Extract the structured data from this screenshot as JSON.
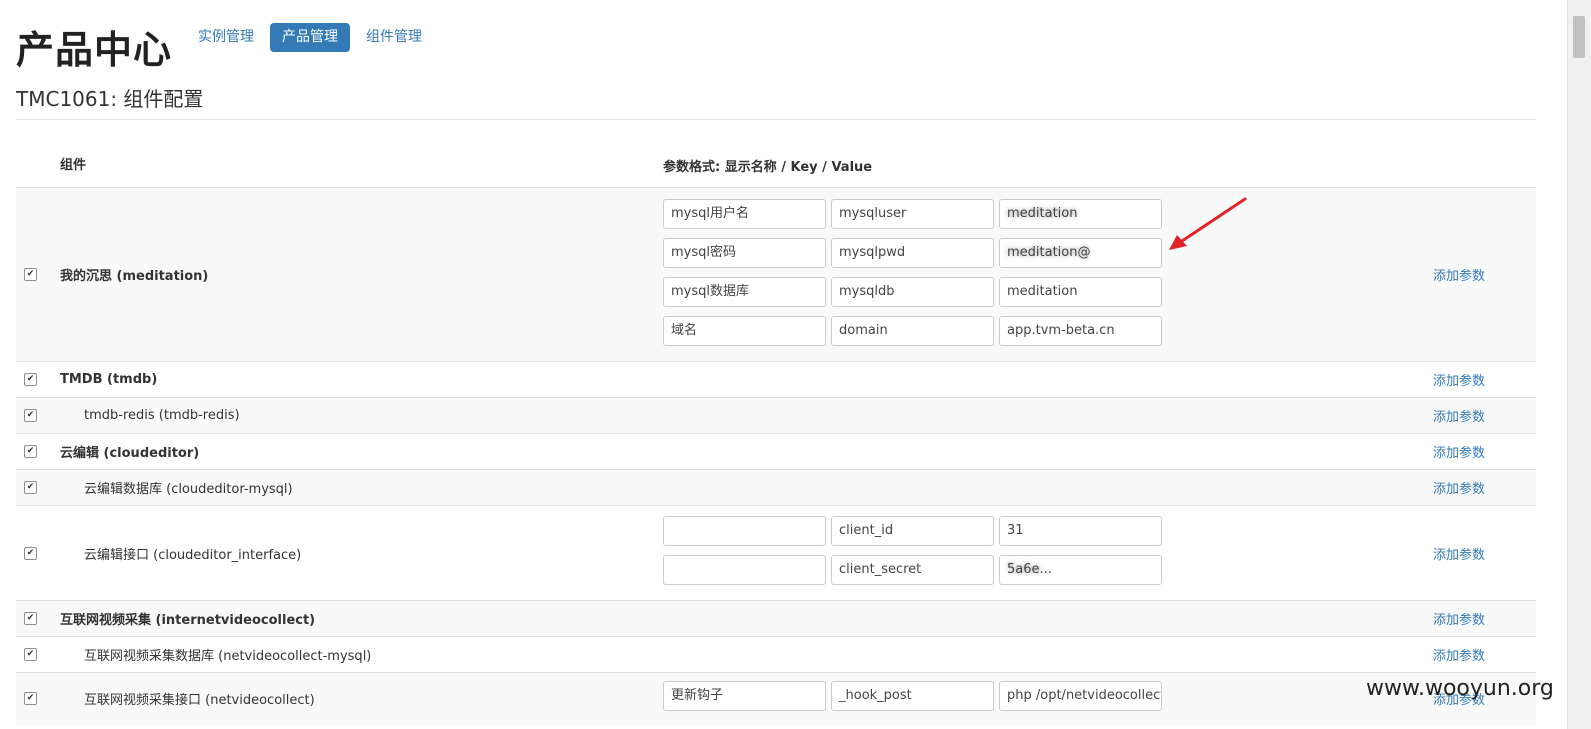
{
  "page": {
    "title": "产品中心",
    "subtitle": "TMC1061: 组件配置"
  },
  "nav": {
    "tabs": [
      {
        "label": "实例管理",
        "active": false
      },
      {
        "label": "产品管理",
        "active": true
      },
      {
        "label": "组件管理",
        "active": false
      }
    ]
  },
  "table": {
    "headers": {
      "component": "组件",
      "params": "参数格式: 显示名称 / Key / Value"
    },
    "add_label": "添加参数",
    "rows": [
      {
        "name": "我的沉思 (meditation)",
        "bold": true,
        "checked": true,
        "params": [
          [
            "mysql用户名",
            "mysqluser",
            "meditation"
          ],
          [
            "mysql密码",
            "mysqlpwd",
            "meditation@"
          ],
          [
            "mysql数据库",
            "mysqldb",
            "meditation"
          ],
          [
            "域名",
            "domain",
            "app.tvm-beta.cn"
          ]
        ]
      },
      {
        "name": "TMDB (tmdb)",
        "bold": true,
        "checked": true,
        "params": []
      },
      {
        "name": "tmdb-redis (tmdb-redis)",
        "bold": false,
        "checked": true,
        "params": []
      },
      {
        "name": "云编辑 (cloudeditor)",
        "bold": true,
        "checked": true,
        "params": []
      },
      {
        "name": "云编辑数据库 (cloudeditor-mysql)",
        "bold": false,
        "checked": true,
        "params": []
      },
      {
        "name": "云编辑接口 (cloudeditor_interface)",
        "bold": false,
        "checked": true,
        "params": [
          [
            "",
            "client_id",
            "31"
          ],
          [
            "",
            "client_secret",
            "5a6e..."
          ]
        ]
      },
      {
        "name": "互联网视频采集 (internetvideocollect)",
        "bold": true,
        "checked": true,
        "params": []
      },
      {
        "name": "互联网视频采集数据库 (netvideocollect-mysql)",
        "bold": false,
        "checked": true,
        "params": []
      },
      {
        "name": "互联网视频采集接口 (netvideocollect)",
        "bold": false,
        "checked": true,
        "params": [
          [
            "更新钩子",
            "_hook_post",
            "php /opt/netvideocollect"
          ]
        ]
      }
    ]
  },
  "watermark": "www.wooyun.org",
  "colors": {
    "accent": "#337ab7",
    "arrow": "#e0242a"
  }
}
